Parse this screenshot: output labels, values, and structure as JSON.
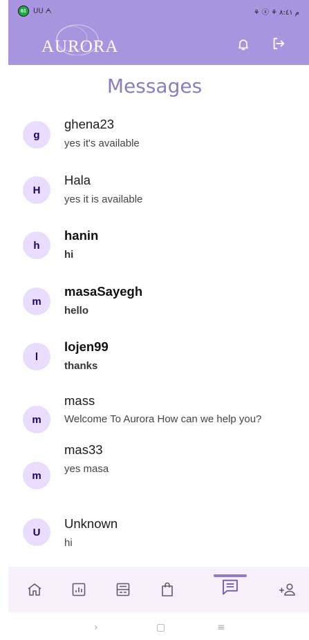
{
  "status_bar": {
    "badge": "61",
    "carrier": "ᑌᑌ ᗅ",
    "right": "⚘ ⓢ ⚘ م ٨:٤١"
  },
  "app_bar": {
    "logo": "AURORA",
    "background": "#a995df",
    "bell_icon": "bell-icon",
    "logout_icon": "logout-icon"
  },
  "page": {
    "title": "Messages"
  },
  "conversations": [
    {
      "initial": "g",
      "name": "ghena23",
      "message": "yes it's available",
      "unread": false
    },
    {
      "initial": "H",
      "name": "Hala",
      "message": "yes it is available",
      "unread": false
    },
    {
      "initial": "h",
      "name": "hanin",
      "message": "hi",
      "unread": true
    },
    {
      "initial": "m",
      "name": "masaSayegh",
      "message": "hello",
      "unread": true
    },
    {
      "initial": "l",
      "name": "lojen99",
      "message": "thanks",
      "unread": true
    },
    {
      "initial": "m",
      "name": "mass",
      "message": "Welcome To Aurora How can we help you?",
      "unread": false
    },
    {
      "initial": "m",
      "name": "mas33",
      "message": "yes masa",
      "unread": false
    },
    {
      "initial": "U",
      "name": "Unknown",
      "message": "hi",
      "unread": false
    }
  ],
  "bottom_nav": {
    "items": [
      "home-icon",
      "dashboard-icon",
      "gallery-icon",
      "shopping-bag-icon",
      "messages-icon",
      "add-person-icon"
    ],
    "selected": 4,
    "accent": "#8f7cc6"
  },
  "system_nav": {
    "back": "›",
    "home": "▢",
    "recents": "≡"
  }
}
